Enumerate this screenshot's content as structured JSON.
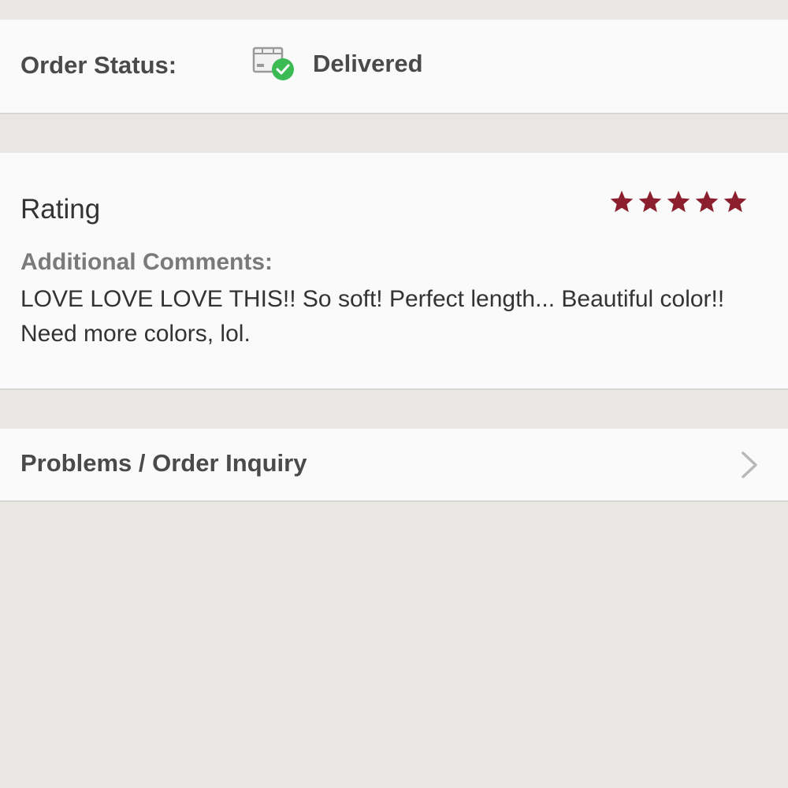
{
  "order_status": {
    "label": "Order Status:",
    "value": "Delivered",
    "icon": "package-delivered-icon",
    "check_color": "#3cba54"
  },
  "rating": {
    "label": "Rating",
    "stars_filled": 5,
    "stars_total": 5,
    "star_color": "#8b1f2e",
    "comments_label": "Additional Comments:",
    "comments_text": "LOVE LOVE LOVE THIS!! So soft! Perfect length... Beautiful color!! Need more colors, lol."
  },
  "problems": {
    "label": "Problems / Order Inquiry",
    "icon": "chevron-right-icon"
  }
}
